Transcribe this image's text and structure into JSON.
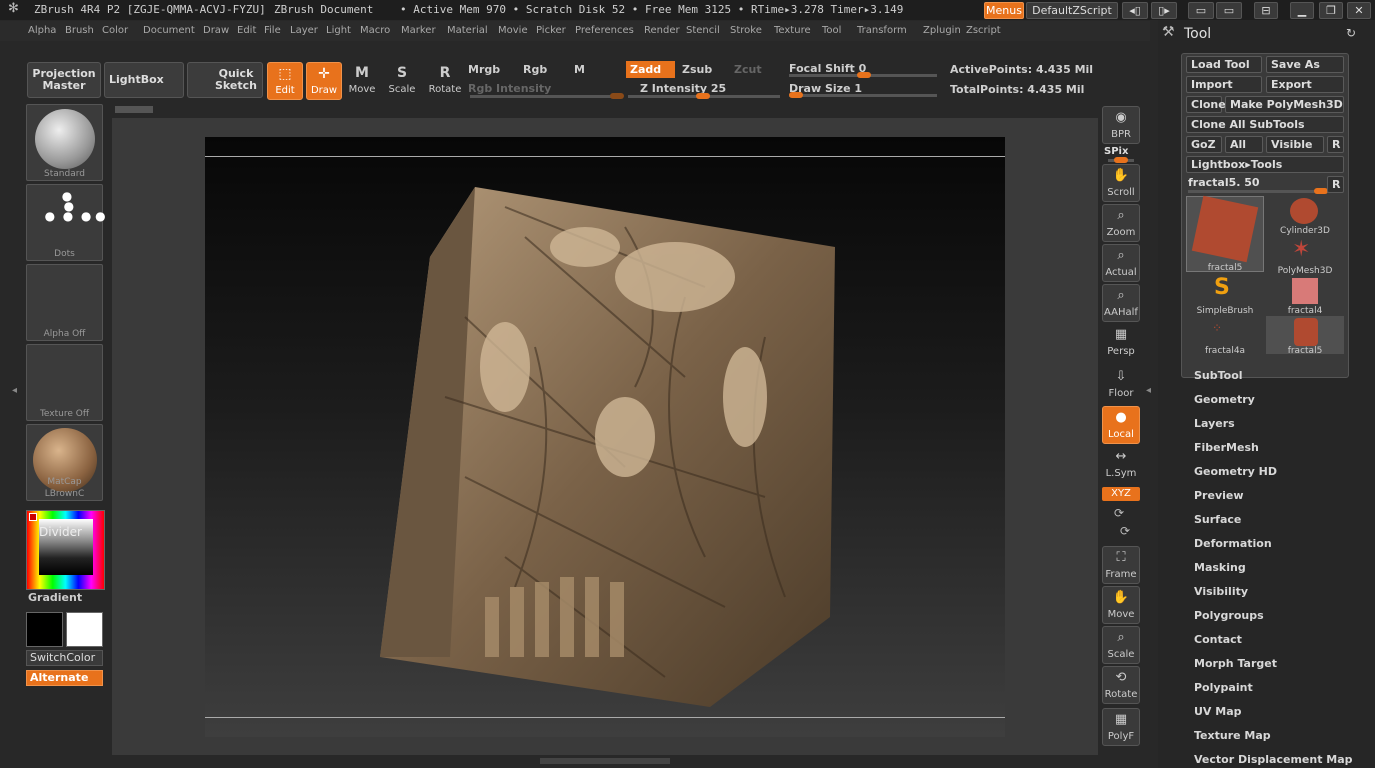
{
  "titlebar": {
    "app": "ZBrush 4R4 P2 [ZGJE-QMMA-ACVJ-FYZU]",
    "doc": "ZBrush Document",
    "stats": "• Active Mem 970 • Scratch Disk 52 • Free Mem 3125 • RTime▸3.278 Timer▸3.149",
    "menus_button": "Menus",
    "script_button": "DefaultZScript"
  },
  "menubar": [
    "Alpha",
    "Brush",
    "Color",
    "Document",
    "Draw",
    "Edit",
    "File",
    "Layer",
    "Light",
    "Macro",
    "Marker",
    "Material",
    "Movie",
    "Picker",
    "Preferences",
    "Render",
    "Stencil",
    "Stroke",
    "Texture",
    "Tool",
    "Transform",
    "Zplugin",
    "Zscript"
  ],
  "toolbar": {
    "projection_master": "Projection Master",
    "lightbox": "LightBox",
    "quick_sketch": "Quick Sketch",
    "edit": "Edit",
    "draw": "Draw",
    "move": "Move",
    "scale": "Scale",
    "rotate": "Rotate",
    "mrgb": "Mrgb",
    "rgb": "Rgb",
    "m": "M",
    "zadd": "Zadd",
    "zsub": "Zsub",
    "zcut": "Zcut",
    "rgb_intensity": "Rgb Intensity",
    "z_intensity": "Z Intensity 25",
    "focal_shift": "Focal Shift 0",
    "draw_size": "Draw Size 1",
    "active_points": "ActivePoints: 4.435 Mil",
    "total_points": "TotalPoints: 4.435 Mil"
  },
  "left": {
    "brush": "Standard",
    "stroke": "Dots",
    "alpha": "Alpha Off",
    "texture": "Texture Off",
    "material": "MatCap LBrownC",
    "divider": "Divider",
    "gradient": "Gradient",
    "switchcolor": "SwitchColor",
    "alternate": "Alternate"
  },
  "rightbar": [
    "BPR",
    "SPix",
    "Scroll",
    "Zoom",
    "Actual",
    "AAHalf",
    "Persp",
    "Floor",
    "Local",
    "L.Sym",
    "XYZ",
    "Frame",
    "Move",
    "Scale",
    "Rotate",
    "PolyF"
  ],
  "tool": {
    "title": "Tool",
    "load": "Load Tool",
    "save": "Save As",
    "import": "Import",
    "export": "Export",
    "clone": "Clone",
    "make_polymesh": "Make PolyMesh3D",
    "clone_all": "Clone All SubTools",
    "goz": "GoZ",
    "all": "All",
    "visible": "Visible",
    "r": "R",
    "lightbox_tools": "Lightbox▸Tools",
    "current": "fractal5. 50",
    "items": [
      "fractal5",
      "Cylinder3D",
      "PolyMesh3D",
      "SimpleBrush",
      "fractal4",
      "fractal4a",
      "fractal5"
    ],
    "sections": [
      "SubTool",
      "Geometry",
      "Layers",
      "FiberMesh",
      "Geometry HD",
      "Preview",
      "Surface",
      "Deformation",
      "Masking",
      "Visibility",
      "Polygroups",
      "Contact",
      "Morph Target",
      "Polypaint",
      "UV Map",
      "Texture Map",
      "Vector Displacement Map"
    ]
  },
  "colors": {
    "accent": "#e8721c"
  }
}
